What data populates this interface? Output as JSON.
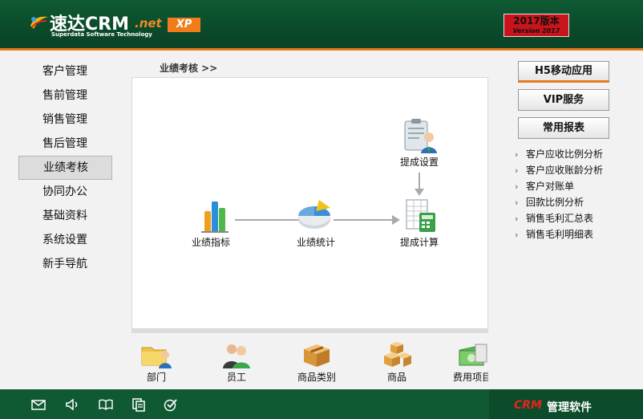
{
  "header": {
    "logo_main": "速达CRM",
    "logo_net": ".net",
    "logo_sub": "Superdata Software Technology",
    "xp_badge": "XP",
    "version_line1": "2017版本",
    "version_line2": "Version 2017"
  },
  "colors": {
    "header_green": "#0f5a33",
    "accent_orange": "#e8791c",
    "version_red": "#c8141a",
    "brand_red": "#e8241c"
  },
  "leftnav": {
    "items": [
      {
        "label": "客户管理"
      },
      {
        "label": "售前管理"
      },
      {
        "label": "销售管理"
      },
      {
        "label": "售后管理"
      },
      {
        "label": "业绩考核",
        "active": true
      },
      {
        "label": "协同办公"
      },
      {
        "label": "基础资料"
      },
      {
        "label": "系统设置"
      },
      {
        "label": "新手导航"
      }
    ]
  },
  "breadcrumb": "业绩考核 >>",
  "flow": {
    "nodes": [
      {
        "label": "业绩指标",
        "icon": "bar-chart-icon"
      },
      {
        "label": "业绩统计",
        "icon": "pie-chart-icon"
      },
      {
        "label": "提成设置",
        "icon": "clipboard-user-icon"
      },
      {
        "label": "提成计算",
        "icon": "spreadsheet-calculator-icon"
      }
    ]
  },
  "quickbar": {
    "items": [
      {
        "label": "部门",
        "icon": "folder-user-icon"
      },
      {
        "label": "员工",
        "icon": "users-icon"
      },
      {
        "label": "商品类别",
        "icon": "box-icon"
      },
      {
        "label": "商品",
        "icon": "boxes-icon"
      },
      {
        "label": "费用项目",
        "icon": "money-icon"
      }
    ]
  },
  "rightpanel": {
    "buttons": [
      {
        "label": "H5移动应用"
      },
      {
        "label": "VIP服务"
      },
      {
        "label": "常用报表"
      }
    ],
    "reports": [
      {
        "label": "客户应收比例分析"
      },
      {
        "label": "客户应收账龄分析"
      },
      {
        "label": "客户对账单"
      },
      {
        "label": "回款比例分析"
      },
      {
        "label": "销售毛利汇总表"
      },
      {
        "label": "销售毛利明细表"
      }
    ]
  },
  "footer": {
    "icons": [
      "mail-icon",
      "speaker-icon",
      "book-icon",
      "copy-icon",
      "check-circle-icon"
    ],
    "brand_crm": "CRM",
    "brand_text": "管理软件"
  }
}
